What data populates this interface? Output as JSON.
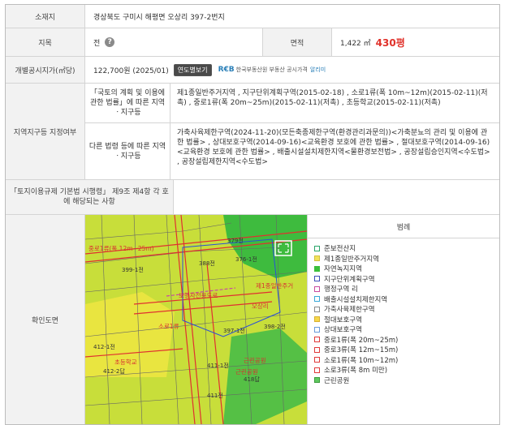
{
  "rows": {
    "address": {
      "label": "소재지",
      "value": "경상북도 구미시 해평면 오상리 397-2번지"
    },
    "jimok": {
      "label": "지목",
      "value": "전",
      "help_icon": "?"
    },
    "area": {
      "label": "면적",
      "value": "1,422 ㎡",
      "pyeong": "430평"
    },
    "price": {
      "label": "개별공시지가(㎡당)",
      "value": "122,700원 (2025/01)",
      "button": "연도별보기",
      "reb_logo": "R€B",
      "reb_text": "한국부동산원 부동산 공시가격",
      "reb_link": "알리미"
    },
    "zone": {
      "label": "지역지구등 지정여부",
      "sub1_label": "「국토의 계획 및 이용에 관한 법률」에 따른 지역ㆍ지구등",
      "sub1_value": "제1종일반주거지역 , 지구단위계획구역(2015-02-18) , 소로1류(폭 10m~12m)(2015-02-11)(저촉) , 중로1류(폭 20m~25m)(2015-02-11)(저촉) , 초등학교(2015-02-11)(저촉)",
      "sub2_label": "다른 법령 등에 따른 지역ㆍ지구등",
      "sub2_value": "가축사육제한구역(2024-11-20)(모든축종제한구역(환경관리과문의))<가축분뇨의 관리 및 이용에 관한 법률> , 상대보호구역(2014-09-16)<교육환경 보호에 관한 법률> , 절대보호구역(2014-09-16)<교육환경 보호에 관한 법률> , 배출시설설치제한지역<물환경보전법> , 공장설립승인지역<수도법> , 공장설립제한지역<수도법>"
    },
    "enforcement": {
      "label": "「토지이용규제 기본법 시행령」 제9조 제4항 각 호에 해당되는 사항",
      "value": ""
    },
    "map": {
      "label": "확인도면"
    }
  },
  "map_labels": {
    "l1": "379전",
    "l2": "376-1전",
    "l3": "388전",
    "l4": "399-1전",
    "l5": "제1종일반주거",
    "l6": "보행자전용도로",
    "l7": "397-1전",
    "l8": "오상리",
    "l9": "398-2전",
    "l10": "412-1전",
    "l11": "412-2답",
    "l12": "초등학교",
    "l13": "411-1전",
    "l14": "근린공원",
    "l15": "418답",
    "l16": "소로1류",
    "l17": "근린공원",
    "l18": "411전",
    "l19": "중로1류(폭 12m~25m)"
  },
  "legend": {
    "title": "범례",
    "items": [
      {
        "label": "준보전산지",
        "color": "#ffffff",
        "border": "#2aa56a"
      },
      {
        "label": "제1종일반주거지역",
        "color": "#f2e35a",
        "border": "#d0c040"
      },
      {
        "label": "자연녹지지역",
        "color": "#3bbf3b",
        "border": "#3bbf3b"
      },
      {
        "label": "지구단위계획구역",
        "color": "#ffffff",
        "border": "#3d4fb8"
      },
      {
        "label": "행정구역 리",
        "color": "#ffffff",
        "border": "#c84ca0"
      },
      {
        "label": "배출시설설치제한지역",
        "color": "#ffffff",
        "border": "#3aa8d8"
      },
      {
        "label": "가축사육제한구역",
        "color": "#ffffff",
        "border": "#8a8a8a"
      },
      {
        "label": "절대보호구역",
        "color": "#f6d84a",
        "border": "#d8b030"
      },
      {
        "label": "상대보호구역",
        "color": "#ffffff",
        "border": "#6a9ad8"
      },
      {
        "label": "중로1류(폭 20m~25m)",
        "color": "#ffffff",
        "border": "#e03a3a"
      },
      {
        "label": "중로3류(폭 12m~15m)",
        "color": "#ffffff",
        "border": "#e03a3a"
      },
      {
        "label": "소로1류(폭 10m~12m)",
        "color": "#ffffff",
        "border": "#e03a3a"
      },
      {
        "label": "소로3류(폭 8m 미만)",
        "color": "#ffffff",
        "border": "#e03a3a"
      },
      {
        "label": "근린공원",
        "color": "#5fc95f",
        "border": "#3a9a3a"
      }
    ]
  }
}
